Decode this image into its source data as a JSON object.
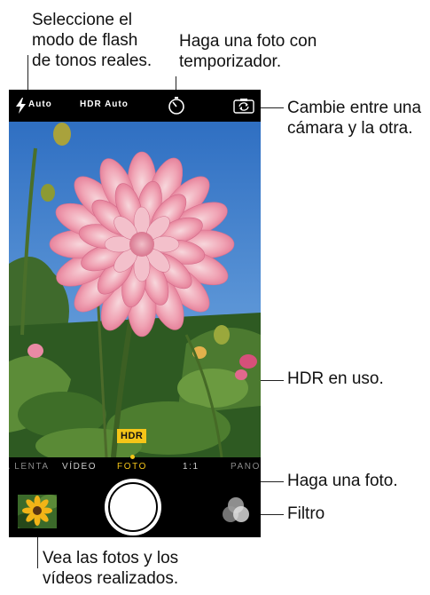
{
  "camera": {
    "flash_label": "Auto",
    "hdr_label": "HDR Auto",
    "hdr_badge": "HDR",
    "modes": [
      "CÁMARA LENTA",
      "VÍDEO",
      "FOTO",
      "1:1",
      "PANO"
    ],
    "selected_mode": "FOTO",
    "accent_color": "#f5c518"
  },
  "annotations": {
    "flash": [
      "Seleccione el",
      "modo de flash",
      "de tonos reales."
    ],
    "timer": [
      "Haga una foto con",
      "temporizador."
    ],
    "switch": [
      "Cambie entre una",
      "cámara y la otra."
    ],
    "hdr": "HDR en uso.",
    "shutter": "Haga una foto.",
    "filter": "Filtro",
    "photos": [
      "Vea las fotos y los",
      "vídeos realizados."
    ]
  }
}
